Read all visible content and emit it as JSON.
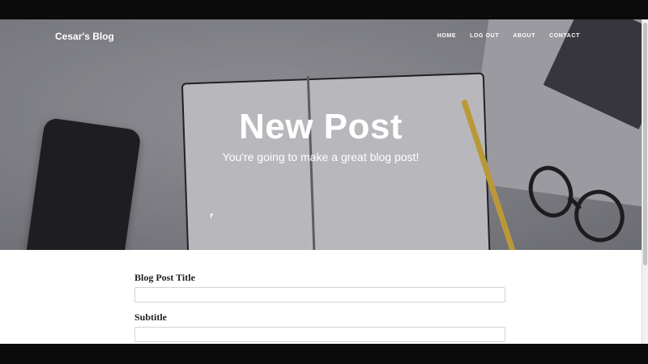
{
  "nav": {
    "brand": "Cesar's Blog",
    "links": [
      "HOME",
      "LOG OUT",
      "ABOUT",
      "CONTACT"
    ]
  },
  "hero": {
    "title": "New Post",
    "subtitle": "You're going to make a great blog post!"
  },
  "form": {
    "fields": [
      {
        "label": "Blog Post Title",
        "value": ""
      },
      {
        "label": "Subtitle",
        "value": ""
      }
    ]
  }
}
